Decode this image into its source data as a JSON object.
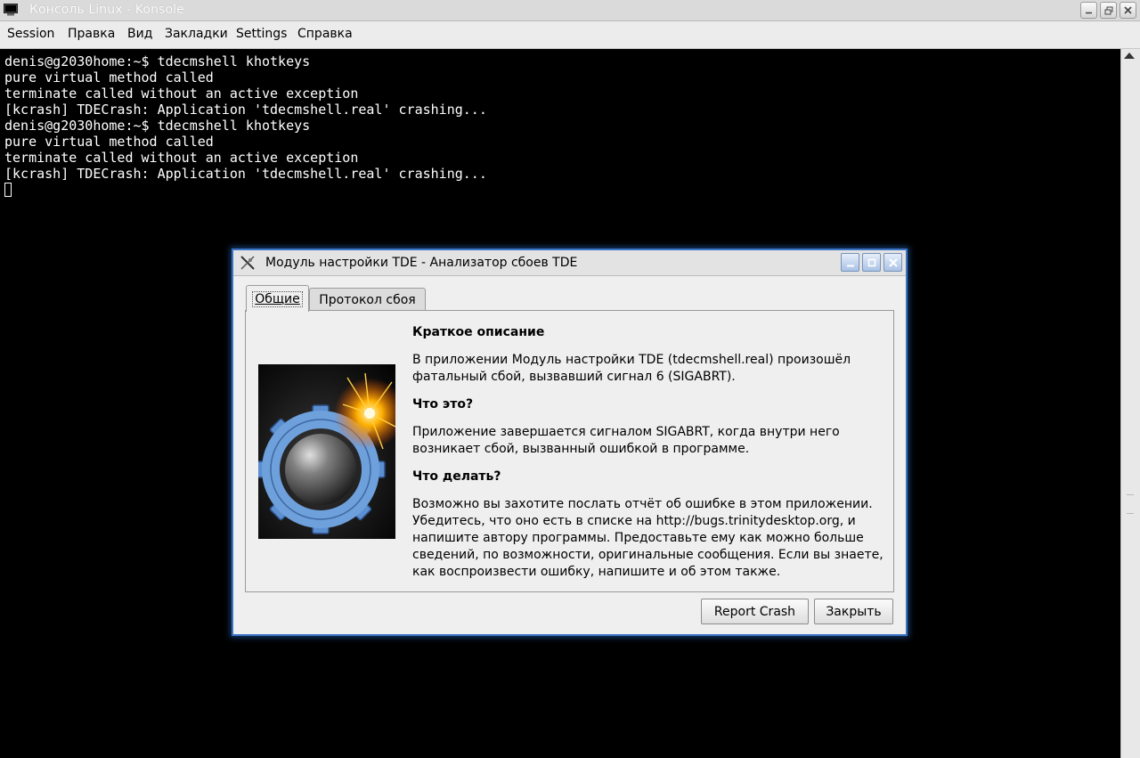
{
  "window": {
    "title": "Консоль Linux - Konsole",
    "icon": "terminal-icon",
    "controls": [
      "minimize-icon",
      "maximize-icon",
      "close-icon"
    ]
  },
  "menubar": {
    "items": [
      "Session",
      "Правка",
      "Вид",
      "Закладки",
      "Settings",
      "Справка"
    ]
  },
  "terminal": {
    "lines": [
      "denis@g2030home:~$ tdecmshell khotkeys",
      "pure virtual method called",
      "terminate called without an active exception",
      "[kcrash] TDECrash: Application 'tdecmshell.real' crashing...",
      "denis@g2030home:~$ tdecmshell khotkeys",
      "pure virtual method called",
      "terminate called without an active exception",
      "[kcrash] TDECrash: Application 'tdecmshell.real' crashing..."
    ]
  },
  "dialog": {
    "title": "Модуль настройки TDE - Анализатор сбоев TDE",
    "tabs": [
      "Общие",
      "Протокол сбоя"
    ],
    "active_tab": "Общие",
    "summary_heading": "Краткое описание",
    "summary_text": "В приложении Модуль настройки TDE (tdecmshell.real) произошёл фатальный сбой, вызвавший сигнал 6 (SIGABRT).",
    "what_heading": "Что это?",
    "what_text": "Приложение завершается сигналом SIGABRT, когда внутри него возникает сбой, вызванный ошибкой в программе.",
    "todo_heading": "Что делать?",
    "todo_text": "Возможно вы захотите послать отчёт об ошибке в этом приложении. Убедитесь, что оно есть в списке на http://bugs.trinitydesktop.org, и напишите автору программы. Предоставьте ему как можно больше сведений, по возможности, оригинальные сообщения. Если вы знаете, как воспроизвести ошибку, напишите и об этом также.",
    "buttons": {
      "report": "Report Crash",
      "close": "Закрыть"
    }
  },
  "colors": {
    "dialog_border": "#3a72c4",
    "terminal_bg": "#000000",
    "terminal_fg": "#ffffff"
  }
}
